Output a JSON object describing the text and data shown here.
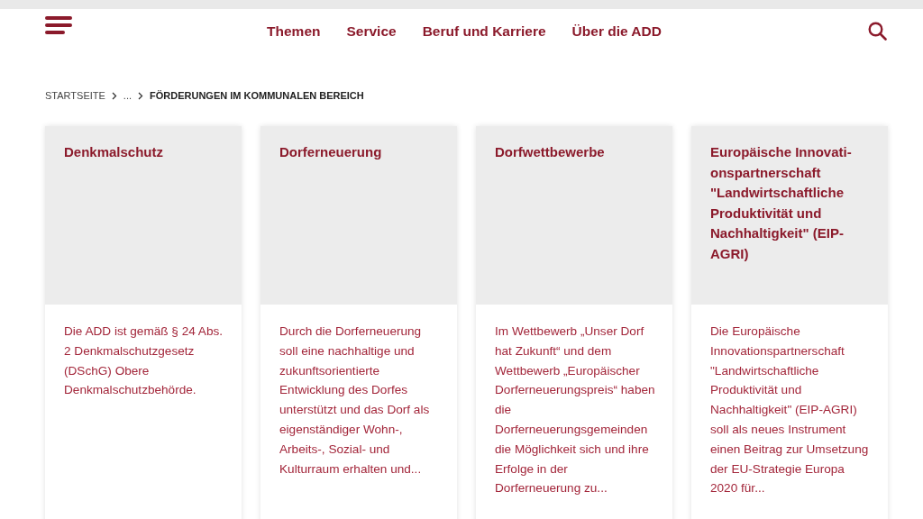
{
  "header": {
    "nav": [
      "Themen",
      "Service",
      "Beruf und Karriere",
      "Über die ADD"
    ]
  },
  "breadcrumb": [
    {
      "label": "STARTSEITE",
      "current": false
    },
    {
      "label": "...",
      "current": false
    },
    {
      "label": "FÖRDERUNGEN IM KOMMUNALEN BEREICH",
      "current": true
    }
  ],
  "cards": [
    {
      "title": "Denkmalschutz",
      "text": "Die ADD ist gemäß § 24 Abs. 2 Denkmalschutzgesetz (DSchG) Obere Denkmalschutzbehörde."
    },
    {
      "title": "Dorferneuerung",
      "text": "Durch die Dorferneuerung soll eine nachhaltige und zukunftsorientierte Entwicklung des Dorfes unterstützt und das Dorf als eigenständiger Wohn-, Arbeits-, Sozial- und Kulturraum erhalten und..."
    },
    {
      "title": "Dorfwettbewerbe",
      "text": "Im Wettbewerb „Unser Dorf hat Zukunft“ und dem Wettbewerb „Europäischer Dorferneuerungspreis“ haben die Dorferneuerungsgemeinden die Möglichkeit sich und ihre Erfolge in der Dorferneuerung zu..."
    },
    {
      "title": "Europäische Innovati-onspartnerschaft \"Landwirtschaftliche Produktivität und Nachhaltigkeit\" (EIP-AGRI)",
      "text": "Die Europäische Innovationspartnerschaft \"Landwirtschaftliche Produktivität und Nachhaltigkeit\" (EIP-AGRI) soll als neues Instrument einen Beitrag zur Umsetzung der EU-Strategie Europa 2020 für..."
    }
  ]
}
